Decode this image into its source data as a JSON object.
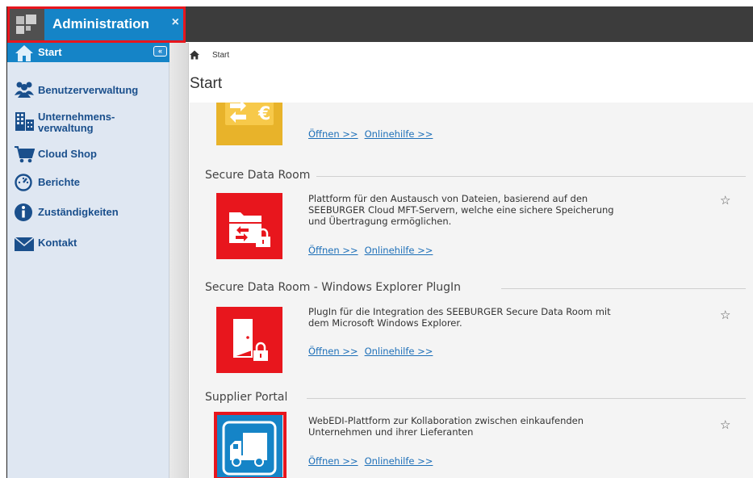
{
  "topbar": {
    "tab_label": "Administration",
    "tab_close": "×"
  },
  "sidebar": {
    "collapse_label": "«",
    "items": [
      {
        "label": "Start",
        "icon": "home-icon"
      },
      {
        "label": "Benutzerverwaltung",
        "icon": "users-icon"
      },
      {
        "label": "Unternehmens-",
        "label2": "verwaltung",
        "icon": "building-icon"
      },
      {
        "label": "Cloud Shop",
        "icon": "cart-icon"
      },
      {
        "label": "Berichte",
        "icon": "gauge-icon"
      },
      {
        "label": "Zuständigkeiten",
        "icon": "info-icon"
      },
      {
        "label": "Kontakt",
        "icon": "envelope-icon"
      }
    ]
  },
  "main": {
    "breadcrumb": "Start",
    "title": "Start",
    "link_open": "Öffnen >>",
    "link_help": "Onlinehilfe >>",
    "star": "☆",
    "cards": [
      {
        "title": "",
        "description": "",
        "icon": "invoice-euro-icon",
        "color": "#e8b32a"
      },
      {
        "title": "Secure Data Room",
        "description": "Plattform für den Austausch von Dateien, basierend auf den SEEBURGER Cloud MFT-Servern, welche eine sichere Speicherung und Übertragung ermöglichen.",
        "icon": "folder-transfer-lock-icon",
        "color": "#e8161d"
      },
      {
        "title": "Secure Data Room - Windows Explorer PlugIn",
        "description": "PlugIn für die Integration des SEEBURGER Secure Data Room mit dem Microsoft Windows Explorer.",
        "icon": "door-lock-icon",
        "color": "#e8161d"
      },
      {
        "title": "Supplier Portal",
        "description": "WebEDI-Plattform zur Kollaboration zwischen einkaufenden Unternehmen und ihrer Lieferanten",
        "icon": "truck-icon",
        "color": "#1584c7"
      }
    ]
  },
  "colors": {
    "accent": "#1584c7",
    "highlight": "#e8161d",
    "topbar": "#3c3c3c",
    "sidebar": "#dfe7f2"
  }
}
